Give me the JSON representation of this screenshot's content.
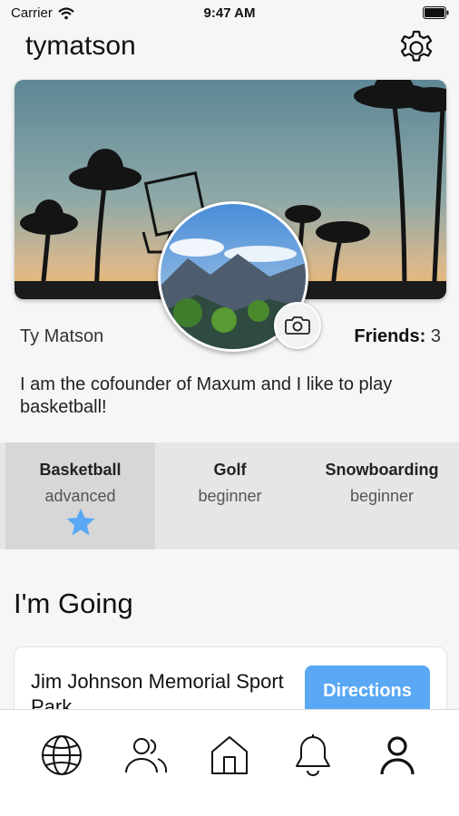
{
  "status_bar": {
    "carrier": "Carrier",
    "time": "9:47 AM"
  },
  "profile": {
    "username": "tymatson",
    "full_name": "Ty Matson",
    "friends_label": "Friends:",
    "friends_count": "3",
    "bio": "I am the cofounder of Maxum and I like to play basketball!"
  },
  "sports": [
    {
      "name": "Basketball",
      "level": "advanced",
      "favorite": true
    },
    {
      "name": "Golf",
      "level": "beginner",
      "favorite": false
    },
    {
      "name": "Snowboarding",
      "level": "beginner",
      "favorite": false
    }
  ],
  "section_title": "I'm Going",
  "event": {
    "name": "Jim Johnson Memorial Sport Park",
    "button_label": "Directions"
  },
  "colors": {
    "accent": "#5aa8f4",
    "background": "#f6f6f6"
  },
  "tabs": [
    {
      "name": "globe",
      "active": false
    },
    {
      "name": "friends",
      "active": false
    },
    {
      "name": "home",
      "active": false
    },
    {
      "name": "notifications",
      "active": false
    },
    {
      "name": "profile",
      "active": true
    }
  ]
}
